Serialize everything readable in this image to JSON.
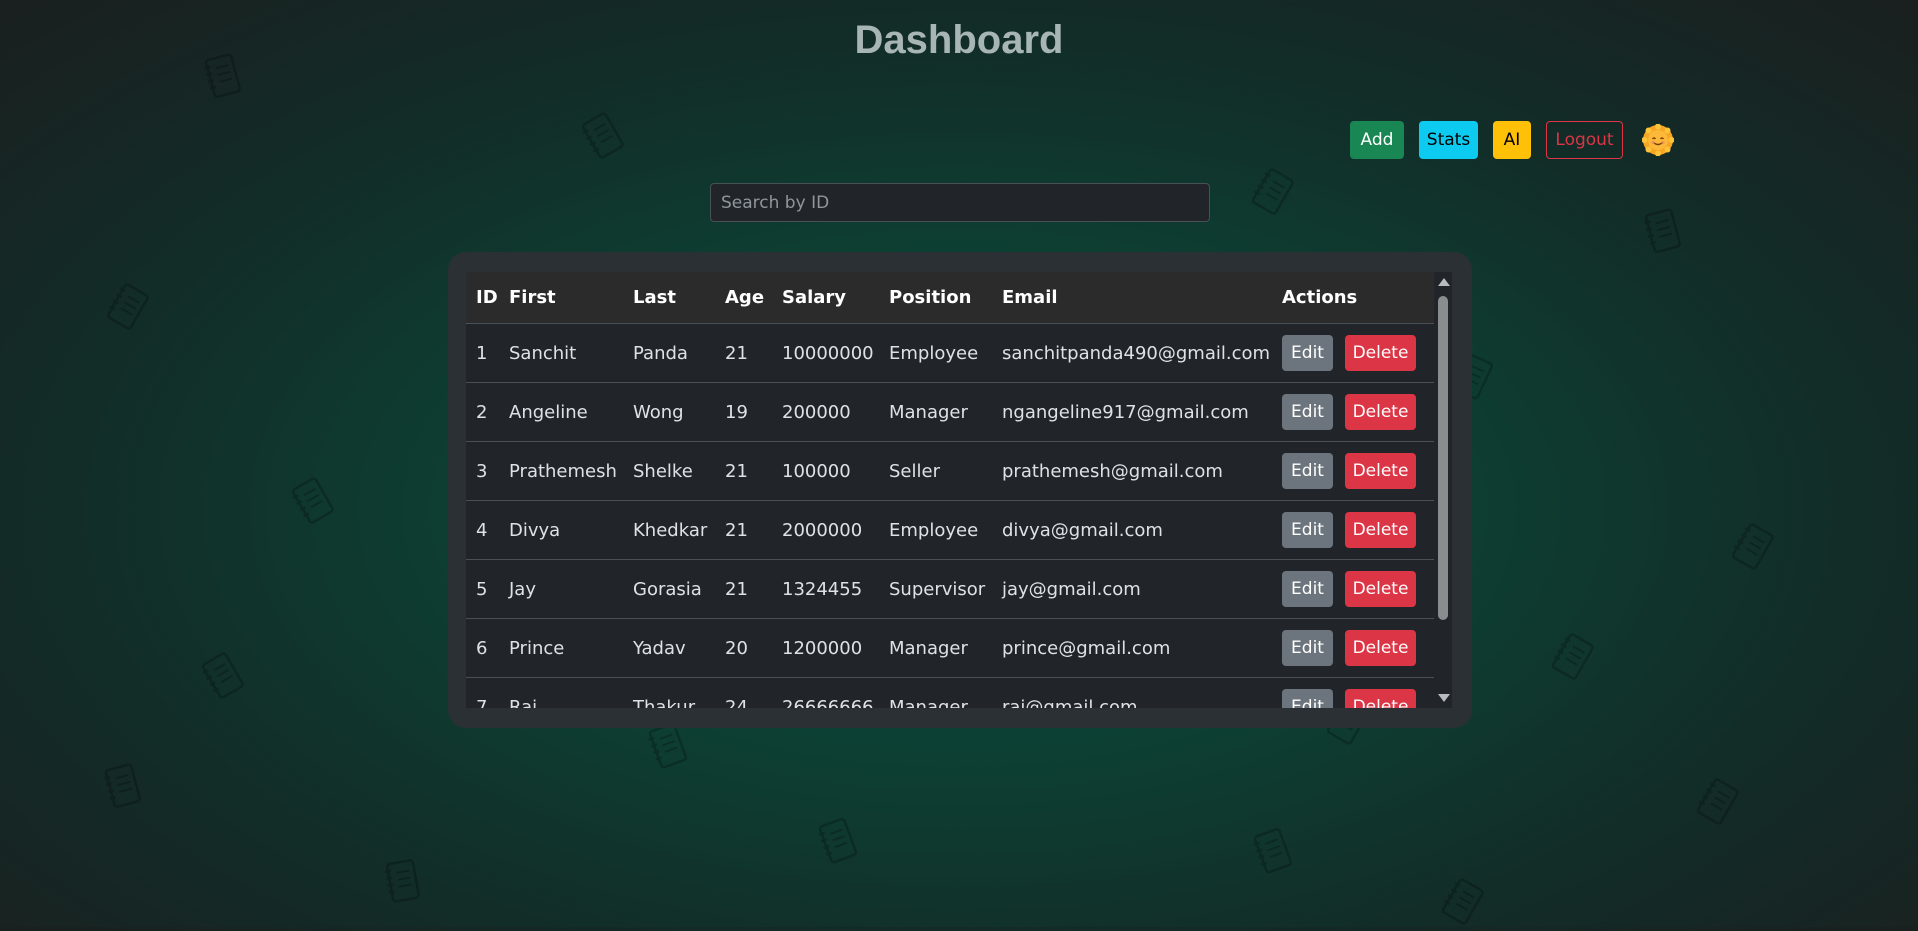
{
  "page": {
    "title": "Dashboard"
  },
  "toolbar": {
    "add_label": "Add",
    "stats_label": "Stats",
    "ai_label": "AI",
    "logout_label": "Logout",
    "theme_icon": "sun-emoji-icon"
  },
  "search": {
    "placeholder": "Search by ID",
    "value": ""
  },
  "table": {
    "columns": [
      "ID",
      "First",
      "Last",
      "Age",
      "Salary",
      "Position",
      "Email",
      "Actions"
    ],
    "rows": [
      {
        "id": "1",
        "first": "Sanchit",
        "last": "Panda",
        "age": "21",
        "salary": "10000000",
        "position": "Employee",
        "email": "sanchitpanda490@gmail.com"
      },
      {
        "id": "2",
        "first": "Angeline",
        "last": "Wong",
        "age": "19",
        "salary": "200000",
        "position": "Manager",
        "email": "ngangeline917@gmail.com"
      },
      {
        "id": "3",
        "first": "Prathemesh",
        "last": "Shelke",
        "age": "21",
        "salary": "100000",
        "position": "Seller",
        "email": "prathemesh@gmail.com"
      },
      {
        "id": "4",
        "first": "Divya",
        "last": "Khedkar",
        "age": "21",
        "salary": "2000000",
        "position": "Employee",
        "email": "divya@gmail.com"
      },
      {
        "id": "5",
        "first": "Jay",
        "last": "Gorasia",
        "age": "21",
        "salary": "1324455",
        "position": "Supervisor",
        "email": "jay@gmail.com"
      },
      {
        "id": "6",
        "first": "Prince",
        "last": "Yadav",
        "age": "20",
        "salary": "1200000",
        "position": "Manager",
        "email": "prince@gmail.com"
      },
      {
        "id": "7",
        "first": "Raj",
        "last": "Thakur",
        "age": "24",
        "salary": "26666666",
        "position": "Manager",
        "email": "raj@gmail.com"
      }
    ],
    "edit_label": "Edit",
    "delete_label": "Delete"
  },
  "colors": {
    "add": "#198754",
    "stats": "#0dcaf0",
    "ai": "#ffc107",
    "logout": "#dc3545",
    "edit": "#6c757d",
    "delete": "#dc3545"
  }
}
